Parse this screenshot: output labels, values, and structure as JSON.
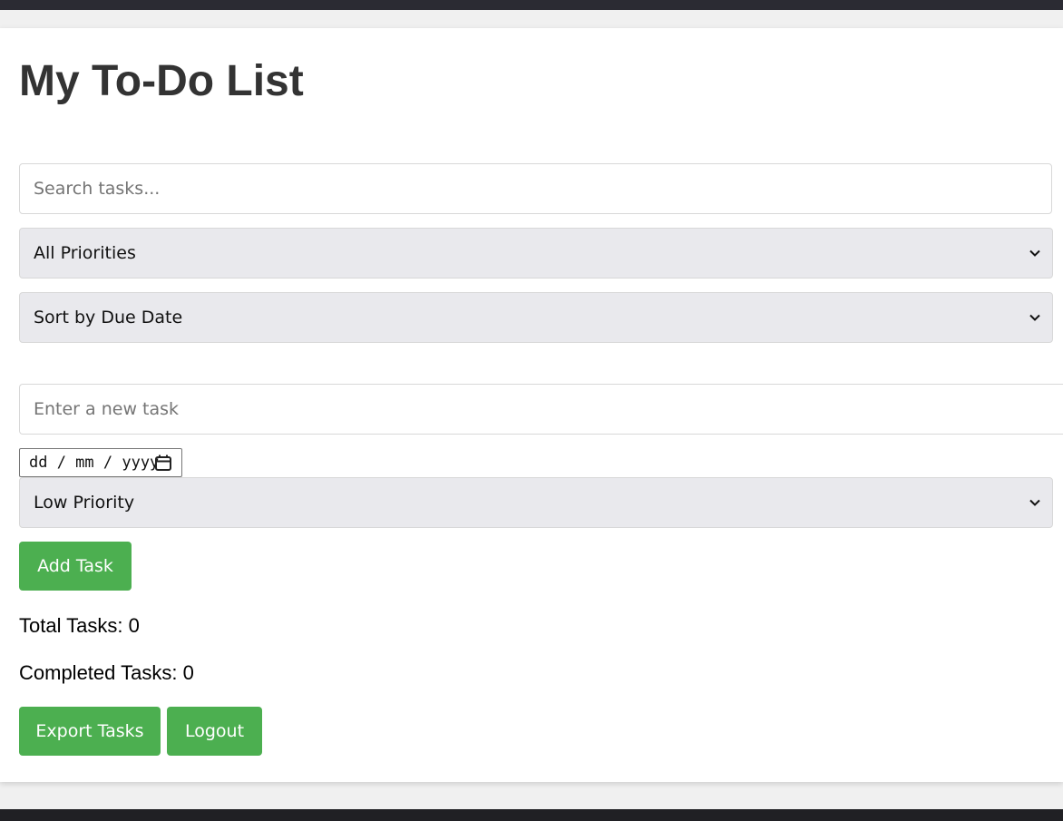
{
  "page": {
    "title": "My To-Do List"
  },
  "filters": {
    "search_placeholder": "Search tasks...",
    "priority_filter_selected": "All Priorities",
    "sort_selected": "Sort by Due Date"
  },
  "new_task": {
    "task_placeholder": "Enter a new task",
    "date_format": "dd / mm / yyyy",
    "priority_selected": "Low Priority",
    "add_button_label": "Add Task"
  },
  "stats": {
    "total_label": "Total Tasks: 0",
    "completed_label": "Completed Tasks: 0"
  },
  "actions": {
    "export_label": "Export Tasks",
    "logout_label": "Logout"
  },
  "colors": {
    "accent": "#4caf50",
    "select_bg": "#e9e9ed",
    "title": "#333333"
  },
  "icons": {
    "select_arrow": "chevron-down-icon",
    "date_picker": "calendar-icon"
  }
}
